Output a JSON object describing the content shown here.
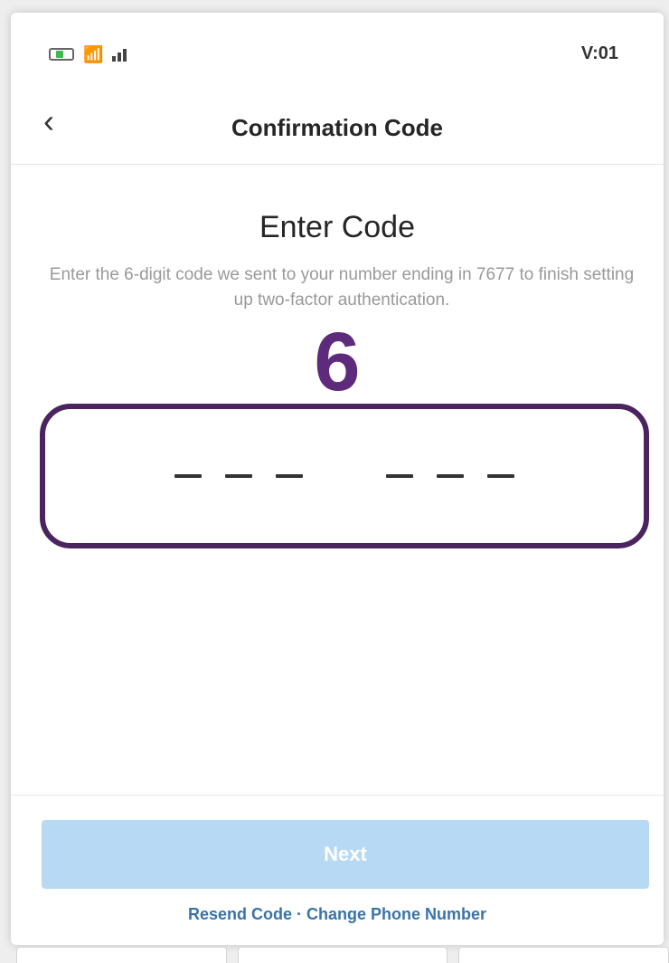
{
  "status_bar": {
    "time": "V:01",
    "wifi_icon": "wifi-icon",
    "signal_icon": "signal-icon",
    "battery_icon": "battery-icon"
  },
  "nav": {
    "back_icon": "chevron-left-icon",
    "back_glyph": "‹",
    "title": "Confirmation Code"
  },
  "main": {
    "heading": "Enter Code",
    "description": "Enter the 6-digit code we sent to your number ending in 7677 to finish setting up two-factor authentication.",
    "step_number": "6"
  },
  "code_input": {
    "digit_count": 6,
    "value": ""
  },
  "footer": {
    "next_label": "Next",
    "resend_label": "Resend Code",
    "separator": " · ",
    "change_phone_label": "Change Phone Number"
  },
  "colors": {
    "accent_purple": "#4b235f",
    "next_button_disabled": "#b8d9f4",
    "link_blue": "#3a73a8"
  }
}
